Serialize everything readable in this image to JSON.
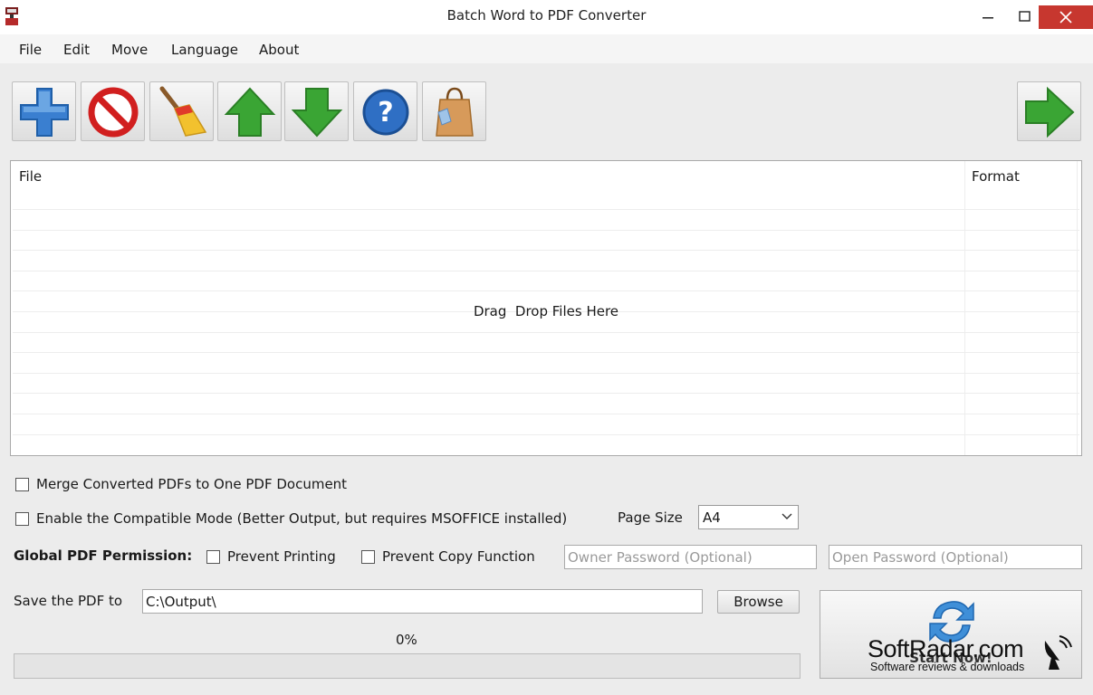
{
  "window": {
    "title": "Batch Word to PDF Converter"
  },
  "menu": {
    "items": [
      "File",
      "Edit",
      "Move",
      "Language",
      "About"
    ]
  },
  "toolbar": {
    "buttons": [
      {
        "icon": "add-plus-icon"
      },
      {
        "icon": "remove-no-icon"
      },
      {
        "icon": "broom-clear-icon"
      },
      {
        "icon": "arrow-up-icon"
      },
      {
        "icon": "arrow-down-icon"
      },
      {
        "icon": "help-question-icon"
      },
      {
        "icon": "shopping-bag-icon"
      },
      {
        "icon": "arrow-right-go-icon"
      }
    ]
  },
  "file_list": {
    "columns": [
      "File",
      "Format"
    ],
    "empty_text": "Drag  Drop Files Here"
  },
  "options": {
    "merge_label": "Merge Converted PDFs to One PDF Document",
    "merge_checked": false,
    "compatible_label": "Enable the Compatible Mode (Better Output, but requires MSOFFICE installed)",
    "compatible_checked": false,
    "page_size_label": "Page Size",
    "page_size_value": "A4"
  },
  "permissions": {
    "label": "Global PDF Permission:",
    "prevent_printing_label": "Prevent Printing",
    "prevent_copy_label": "Prevent Copy Function",
    "owner_password_placeholder": "Owner Password (Optional)",
    "open_password_placeholder": "Open Password (Optional)"
  },
  "output": {
    "save_label": "Save the PDF to",
    "path_value": "C:\\Output\\",
    "browse_label": "Browse"
  },
  "progress": {
    "percent_text": "0%",
    "value": 0
  },
  "start": {
    "label": "Start Now!"
  },
  "watermark": {
    "title": "SoftRadar.com",
    "subtitle": "Software reviews & downloads"
  },
  "colors": {
    "close_button": "#c7372f",
    "accent_blue": "#3a7fd0",
    "accent_green": "#3aa534"
  }
}
